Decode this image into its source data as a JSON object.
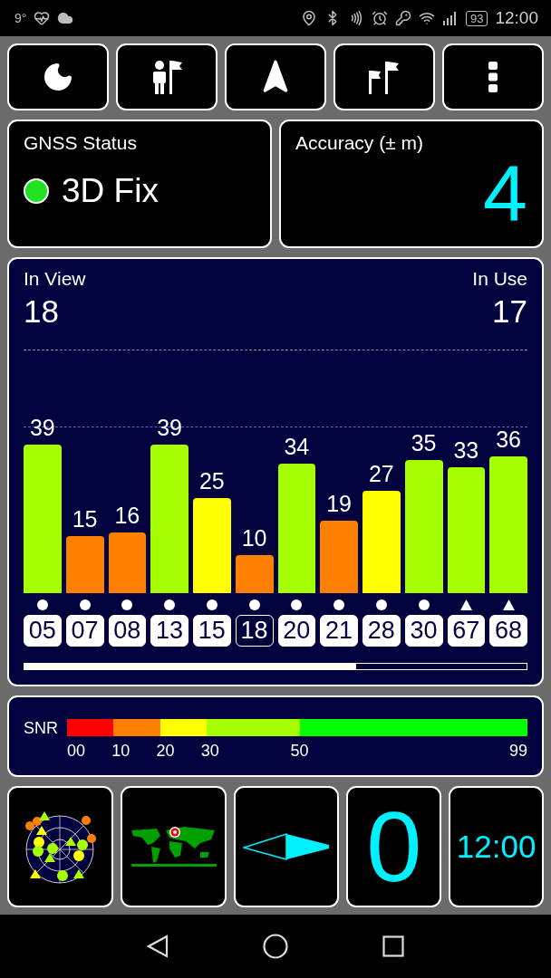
{
  "status_bar": {
    "temperature": "9°",
    "battery": "93",
    "time": "12:00"
  },
  "gnss_status": {
    "title": "GNSS Status",
    "fix": "3D Fix"
  },
  "accuracy": {
    "title": "Accuracy (± m)",
    "value": "4"
  },
  "satellites": {
    "in_view_label": "In View",
    "in_view": "18",
    "in_use_label": "In Use",
    "in_use": "17",
    "chart_data": {
      "type": "bar",
      "categories": [
        "05",
        "07",
        "08",
        "13",
        "15",
        "18",
        "20",
        "21",
        "28",
        "30",
        "67",
        "68"
      ],
      "values": [
        39,
        15,
        16,
        39,
        25,
        10,
        34,
        19,
        27,
        35,
        33,
        36
      ],
      "data_labels": true
    },
    "markers": [
      {
        "kind": "circle",
        "in_use": true
      },
      {
        "kind": "circle",
        "in_use": true
      },
      {
        "kind": "circle",
        "in_use": true
      },
      {
        "kind": "circle",
        "in_use": true
      },
      {
        "kind": "circle",
        "in_use": true
      },
      {
        "kind": "circle",
        "in_use": false
      },
      {
        "kind": "circle",
        "in_use": true
      },
      {
        "kind": "circle",
        "in_use": true
      },
      {
        "kind": "circle",
        "in_use": true
      },
      {
        "kind": "circle",
        "in_use": true
      },
      {
        "kind": "triangle",
        "in_use": true
      },
      {
        "kind": "triangle",
        "in_use": true
      }
    ]
  },
  "snr_legend": {
    "label": "SNR",
    "ticks": [
      "00",
      "10",
      "20",
      "30",
      "50",
      "99"
    ]
  },
  "bottom_tiles": {
    "speed": "0",
    "clock": "12:00"
  }
}
